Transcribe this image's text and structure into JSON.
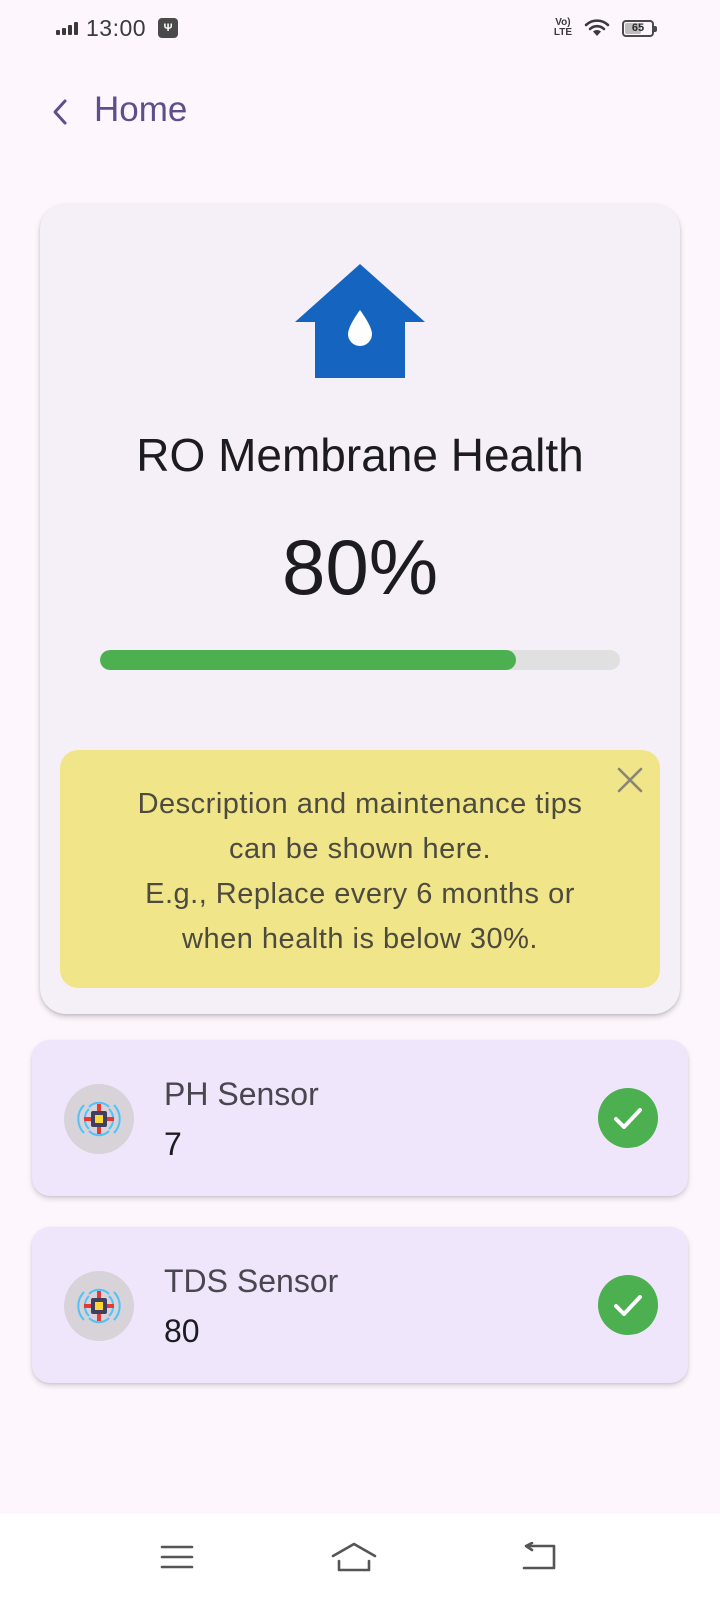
{
  "status_bar": {
    "time": "13:00",
    "network": "VoLTE",
    "battery": "65",
    "battery_level": 0.65
  },
  "app_bar": {
    "title": "Home"
  },
  "membrane": {
    "title": "RO Membrane Health",
    "value_text": "80%",
    "health_fraction": 0.8,
    "icon": "water-house-icon",
    "icon_color": "#1565c0",
    "progress_color": "#4caf50",
    "tips": [
      "Description and maintenance tips",
      "can be shown here.",
      "E.g., Replace every 6 months or",
      "when health is below 30%."
    ]
  },
  "sensors": [
    {
      "name": "PH Sensor",
      "value": "7",
      "icon": "sensor-chip-icon",
      "status": "ok"
    },
    {
      "name": "TDS Sensor",
      "value": "80",
      "icon": "sensor-chip-icon",
      "status": "ok"
    }
  ],
  "nav": {
    "items": [
      "menu-icon",
      "home-icon",
      "back-icon"
    ]
  }
}
